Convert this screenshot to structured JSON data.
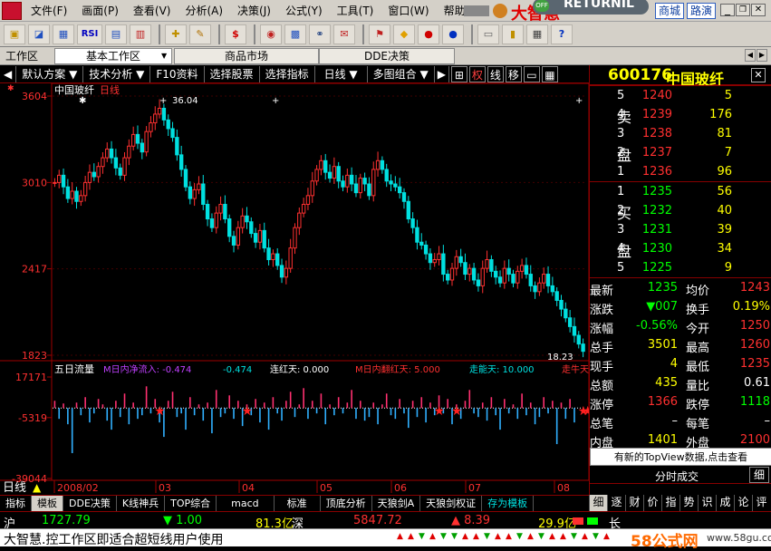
{
  "menu": {
    "items": [
      "文件(F)",
      "画面(P)",
      "查看(V)",
      "分析(A)",
      "决策(J)",
      "公式(Y)",
      "工具(T)",
      "窗口(W)",
      "帮助(H)"
    ],
    "brand": "大智慧",
    "returnil": "RETURNIL",
    "badge_off": "OFF",
    "btn_mall": "商城",
    "btn_roadshow": "路演"
  },
  "toolbar": {
    "rsi": "RSI",
    "dollar": "$"
  },
  "workbar": {
    "label": "工作区",
    "tabs": [
      "基本工作区",
      "商品市场",
      "DDE决策"
    ]
  },
  "funcbar": {
    "items": [
      "默认方案",
      "技术分析",
      "F10资料",
      "选择股票",
      "选择指标",
      "日线",
      "多图组合"
    ],
    "right_labels": [
      "权",
      "线",
      "移"
    ]
  },
  "chart": {
    "title": "中国玻纤",
    "period": "日线",
    "price_ticks": [
      "3604",
      "3010",
      "2417",
      "1823"
    ],
    "high_label": "36.04",
    "low_label": "18.23",
    "indicator": {
      "name": "五日流量",
      "legend": [
        "M日内净流入: -0.474",
        "-0.474",
        "连红天: 0.000",
        "M日内翻红天: 5.000",
        "走能天: 10.000",
        "走牛天"
      ],
      "ticks": [
        "17171",
        "-5319",
        "-39044"
      ]
    },
    "date_axis": {
      "label": "日线",
      "dates": [
        "2008/02",
        "03",
        "04",
        "05",
        "06",
        "07",
        "08"
      ]
    }
  },
  "chart_data": {
    "type": "candlestick",
    "title": "中国玻纤 日线",
    "price_ylim": [
      1823,
      3604
    ],
    "price_ticks": [
      3604,
      3010,
      2417,
      1823
    ],
    "high": 3604,
    "low": 1823,
    "closes": [
      3010,
      3060,
      2980,
      2900,
      2950,
      2880,
      2920,
      3010,
      3080,
      3050,
      3120,
      3180,
      3240,
      3180,
      3110,
      3060,
      3180,
      3260,
      3340,
      3280,
      3220,
      3360,
      3420,
      3480,
      3520,
      3440,
      3380,
      3320,
      3200,
      3100,
      2980,
      2900,
      2960,
      3000,
      2860,
      2760,
      2700,
      2800,
      2860,
      2760,
      2640,
      2580,
      2700,
      2780,
      2740,
      2660,
      2600,
      2680,
      2560,
      2480,
      2520,
      2440,
      2360,
      2420,
      2560,
      2700,
      2800,
      2860,
      2920,
      3020,
      3100,
      3160,
      3080,
      3040,
      3120,
      3020,
      2980,
      3060,
      3000,
      2940,
      3040,
      3000,
      2920,
      3100,
      3160,
      3100,
      3020,
      3000,
      2980,
      2940,
      2880,
      2760,
      2700,
      2600,
      2580,
      2520,
      2460,
      2480,
      2520,
      2380,
      2340,
      2420,
      2500,
      2460,
      2380,
      2420,
      2340,
      2300,
      2420,
      2480,
      2400,
      2360,
      2320,
      2420,
      2380,
      2320,
      2400,
      2440,
      2380,
      2300,
      2260,
      2320,
      2380,
      2300,
      2260,
      2200,
      2140,
      2080,
      2020,
      1960,
      1900,
      1850
    ],
    "flow_ylim": [
      -39044,
      17171
    ],
    "flow_ticks": [
      17171,
      -5319,
      -39044
    ],
    "flow": [
      4000,
      -6000,
      2500,
      -9000,
      -25000,
      3000,
      -4000,
      6000,
      -8000,
      -3000,
      5000,
      2000,
      -7000,
      -12000,
      4000,
      -5000,
      8000,
      -9000,
      3000,
      -6000,
      -4000,
      12000,
      -3000,
      5000,
      -8000,
      -16000,
      4000,
      9000,
      -5000,
      -3000,
      -12000,
      6000,
      -4000,
      2000,
      -7000,
      3000,
      -14000,
      10000,
      -5000,
      -3000,
      7000,
      -6000,
      4000,
      -10000,
      2000,
      -4000,
      5000,
      -8000,
      3000,
      -12000,
      6000,
      -3000,
      -7000,
      4000,
      9000,
      -5000,
      2000,
      11000,
      -6000,
      4000,
      -3000,
      8000,
      -9000,
      2000,
      -4000,
      6000,
      -3000,
      3000,
      10000,
      -6000,
      4000,
      -7000,
      -5000,
      3000,
      -9000,
      2000,
      8000,
      -4000,
      -6000,
      5000,
      -3000,
      -11000,
      4000,
      -5000,
      6000,
      -8000,
      3000,
      -4000,
      7000,
      -3000,
      5000,
      -9000,
      2000,
      -6000,
      4000,
      10000,
      -3000,
      -5000,
      3000,
      -7000,
      6000,
      -4000,
      -12000,
      5000,
      -3000,
      2000,
      -6000,
      8000,
      -4000,
      3000,
      -9000,
      -5000,
      6000,
      -3000,
      4000,
      -20000,
      3000,
      -6000,
      5000,
      -8000
    ],
    "star_positions": [
      24,
      44,
      88,
      92,
      121,
      122
    ],
    "dates": [
      "2008/02",
      "03",
      "04",
      "05",
      "06",
      "07",
      "08"
    ]
  },
  "quote": {
    "code": "600176",
    "name": "中国玻纤",
    "sell_label": [
      "卖",
      "盘"
    ],
    "buy_label": [
      "买",
      "盘"
    ],
    "sell": [
      {
        "lvl": "5",
        "price": "1240",
        "vol": "5"
      },
      {
        "lvl": "4",
        "price": "1239",
        "vol": "176"
      },
      {
        "lvl": "3",
        "price": "1238",
        "vol": "81"
      },
      {
        "lvl": "2",
        "price": "1237",
        "vol": "7"
      },
      {
        "lvl": "1",
        "price": "1236",
        "vol": "96"
      }
    ],
    "buy": [
      {
        "lvl": "1",
        "price": "1235",
        "vol": "56"
      },
      {
        "lvl": "2",
        "price": "1232",
        "vol": "40"
      },
      {
        "lvl": "3",
        "price": "1231",
        "vol": "39"
      },
      {
        "lvl": "4",
        "price": "1230",
        "vol": "34"
      },
      {
        "lvl": "5",
        "price": "1225",
        "vol": "9"
      }
    ],
    "stats": [
      {
        "l1": "最新",
        "v1": "1235",
        "l2": "均价",
        "v2": "1243"
      },
      {
        "l1": "涨跌",
        "v1": "▼007",
        "l2": "换手",
        "v2": "0.19%"
      },
      {
        "l1": "涨幅",
        "v1": "-0.56%",
        "l2": "今开",
        "v2": "1250"
      },
      {
        "l1": "总手",
        "v1": "3501",
        "l2": "最高",
        "v2": "1260"
      },
      {
        "l1": "现手",
        "v1": "4",
        "l2": "最低",
        "v2": "1235"
      },
      {
        "l1": "总额",
        "v1": "435",
        "l2": "量比",
        "v2": "0.61"
      },
      {
        "l1": "涨停",
        "v1": "1366",
        "l2": "跌停",
        "v2": "1118"
      },
      {
        "l1": "总笔",
        "v1": "–",
        "l2": "每笔",
        "v2": "–"
      },
      {
        "l1": "内盘",
        "v1": "1401",
        "l2": "外盘",
        "v2": "2100"
      }
    ],
    "topview_notice": "有新的TopView数据,点击查看",
    "tick_label": "分时成交",
    "tick_btn": "细"
  },
  "bottom_tabs": [
    "指标",
    "模板",
    "DDE决策",
    "K线神兵",
    "TOP综合",
    "macd",
    "标准",
    "顶底分析",
    "天狼剑A",
    "天狼剑权证",
    "存为模板"
  ],
  "right_tabs": [
    "细",
    "逐",
    "财",
    "价",
    "指",
    "势",
    "识",
    "成",
    "论",
    "评"
  ],
  "index_bar": {
    "sh_label": "沪",
    "sh_value": "1727.79",
    "sh_change": "▼ 1.00",
    "sh_amount": "81.3亿",
    "sz_label": "深",
    "sz_value": "5847.72",
    "sz_change": "▲ 8.39",
    "sz_amount": "29.9亿",
    "long_label": "长"
  },
  "status": {
    "text": "大智慧.控工作区即适合超短线用户使用",
    "watermark": "58公式网",
    "url": "www.58gu.com"
  }
}
